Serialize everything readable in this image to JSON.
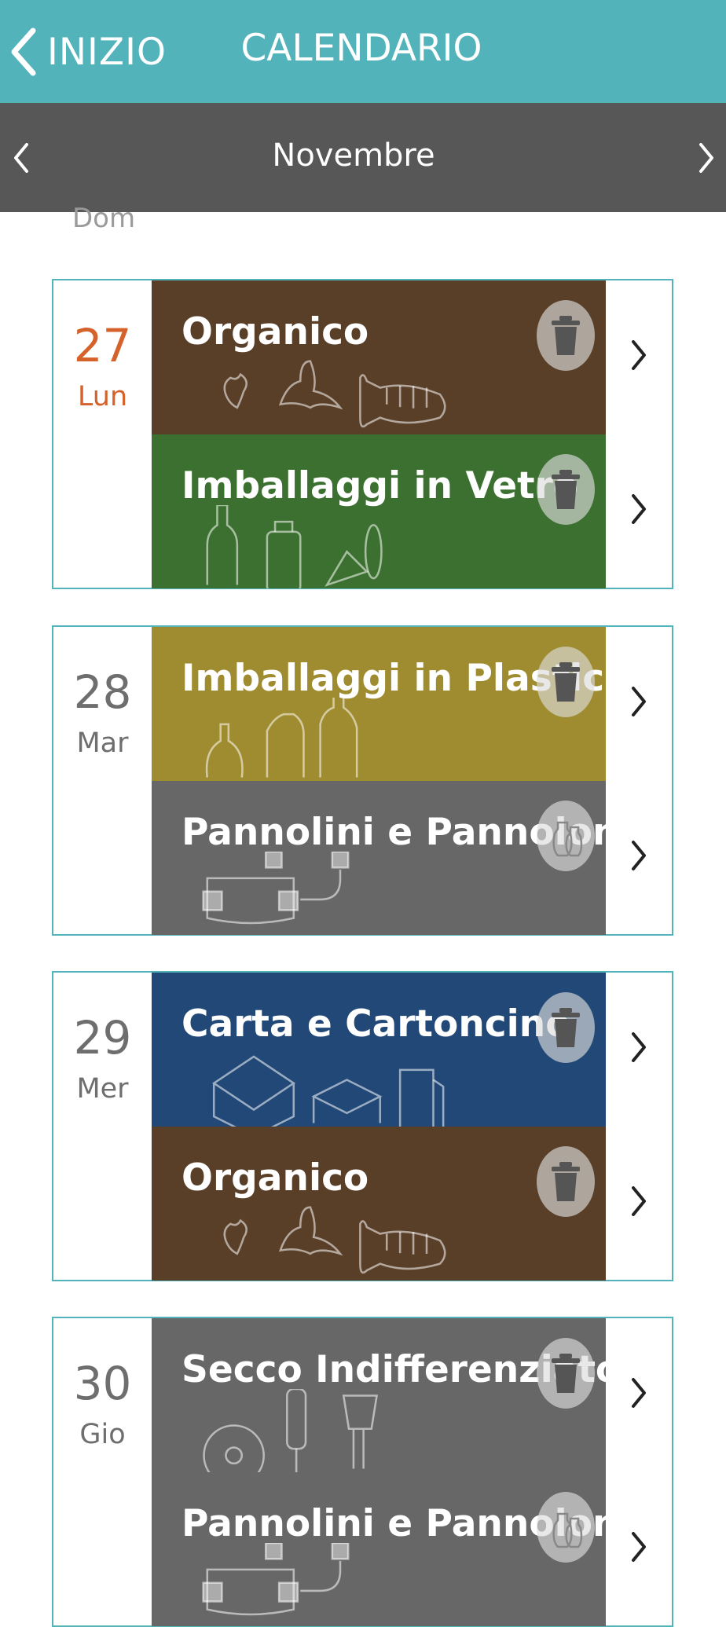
{
  "header": {
    "back_label": "INIZIO",
    "title": "CALENDARIO"
  },
  "month_nav": {
    "month": "Novembre"
  },
  "partial_day_label": "Dom",
  "days": [
    {
      "number": "27",
      "name": "Lun",
      "today": true,
      "events": [
        {
          "label": "Organico",
          "color": "#5a3f28",
          "icon": "trash-icon",
          "illustration": "organic"
        },
        {
          "label": "Imballaggi in Vetro",
          "color": "#3c7030",
          "icon": "trash-icon",
          "illustration": "glass"
        }
      ]
    },
    {
      "number": "28",
      "name": "Mar",
      "today": false,
      "events": [
        {
          "label": "Imballaggi in Plastica",
          "color": "#a08c30",
          "icon": "trash-icon",
          "illustration": "plastic"
        },
        {
          "label": "Pannolini e Pannoloni",
          "color": "#676767",
          "icon": "bags-icon",
          "illustration": "diapers"
        }
      ]
    },
    {
      "number": "29",
      "name": "Mer",
      "today": false,
      "events": [
        {
          "label": "Carta e Cartoncino",
          "color": "#214876",
          "icon": "trash-icon",
          "illustration": "paper"
        },
        {
          "label": "Organico",
          "color": "#5a3f28",
          "icon": "trash-icon",
          "illustration": "organic"
        }
      ]
    },
    {
      "number": "30",
      "name": "Gio",
      "today": false,
      "events": [
        {
          "label": "Secco Indifferenziato",
          "color": "#676767",
          "icon": "trash-icon",
          "illustration": "dry"
        },
        {
          "label": "Pannolini e Pannoloni",
          "color": "#676767",
          "icon": "bags-icon",
          "illustration": "diapers"
        }
      ]
    }
  ],
  "colors": {
    "header_bg": "#52b3bb",
    "month_bar_bg": "#575757",
    "card_border": "#52b3bb",
    "today_text": "#d4622a",
    "day_text": "#6e6e6e"
  }
}
